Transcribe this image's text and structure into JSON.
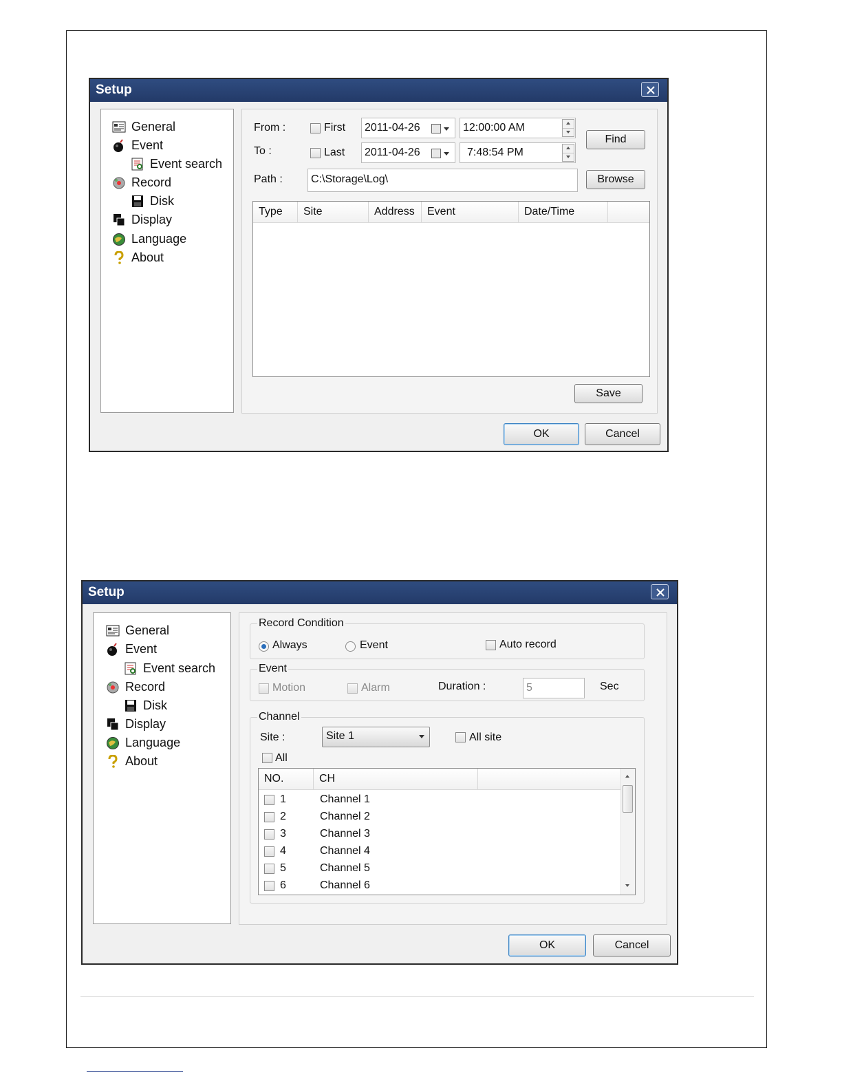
{
  "dialog1": {
    "title": "Setup",
    "nav": [
      "General",
      "Event",
      "Event search",
      "Record",
      "Disk",
      "Display",
      "Language",
      "About"
    ],
    "nav_icons": [
      "general-icon",
      "event-icon",
      "event-search-icon",
      "record-icon",
      "disk-icon",
      "display-icon",
      "language-icon",
      "about-icon"
    ],
    "from_label": "From :",
    "to_label": "To :",
    "first_label": "First",
    "last_label": "Last",
    "from_date": "2011-04-26",
    "from_time": "12:00:00 AM",
    "to_date": "2011-04-26",
    "to_time": "7:48:54 PM",
    "path_label": "Path  :",
    "path_value": "C:\\Storage\\Log\\",
    "find_button": "Find",
    "browse_button": "Browse",
    "columns": [
      "Type",
      "Site",
      "Address",
      "Event",
      "Date/Time"
    ],
    "save_button": "Save",
    "ok_button": "OK",
    "cancel_button": "Cancel"
  },
  "dialog2": {
    "title": "Setup",
    "nav": [
      "General",
      "Event",
      "Event search",
      "Record",
      "Disk",
      "Display",
      "Language",
      "About"
    ],
    "record_condition_legend": "Record Condition",
    "always_label": "Always",
    "event_option_label": "Event",
    "auto_record_label": "Auto record",
    "selected_condition": "Always",
    "event_legend": "Event",
    "motion_label": "Motion",
    "alarm_label": "Alarm",
    "duration_label": "Duration :",
    "duration_value": "5",
    "duration_unit": "Sec",
    "channel_legend": "Channel",
    "site_label": "Site :",
    "site_selected": "Site 1",
    "all_site_label": "All site",
    "all_label": "All",
    "columns": [
      "NO.",
      "CH"
    ],
    "channels": [
      {
        "no": "1",
        "ch": "Channel 1"
      },
      {
        "no": "2",
        "ch": "Channel 2"
      },
      {
        "no": "3",
        "ch": "Channel 3"
      },
      {
        "no": "4",
        "ch": "Channel 4"
      },
      {
        "no": "5",
        "ch": "Channel 5"
      },
      {
        "no": "6",
        "ch": "Channel 6"
      }
    ],
    "ok_button": "OK",
    "cancel_button": "Cancel"
  },
  "colors": {
    "titlebar": "#2f4c80",
    "radio_selected": "#2a6ebb",
    "default_button_border": "#3b83c4"
  }
}
